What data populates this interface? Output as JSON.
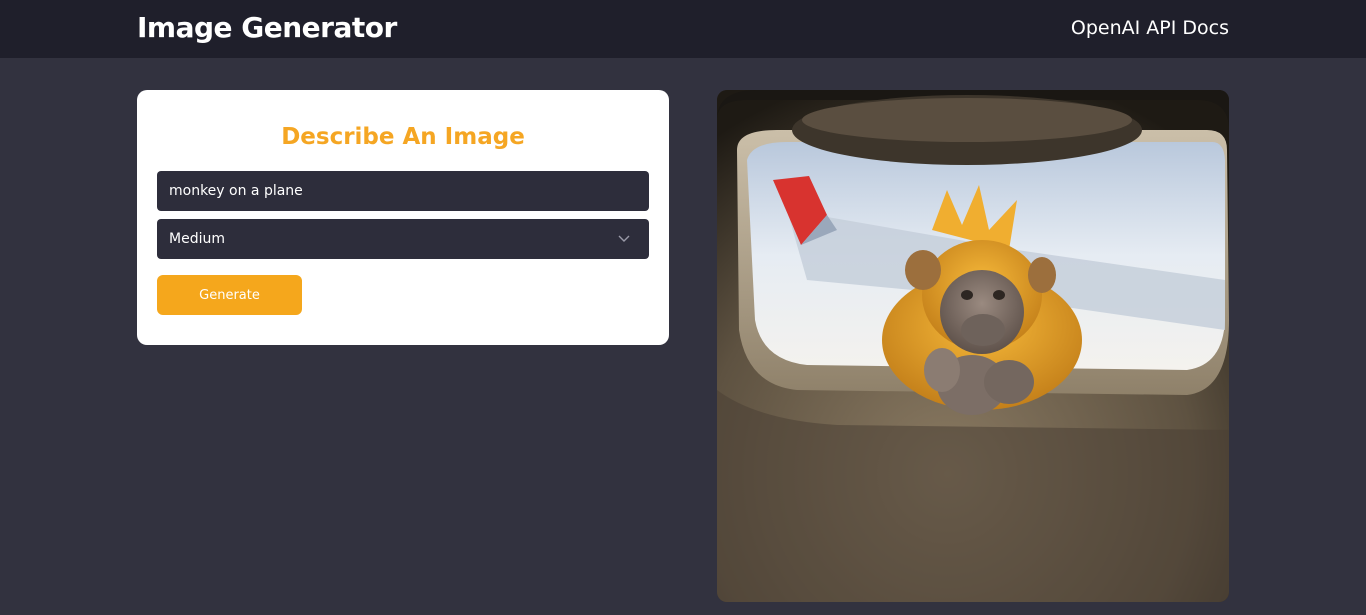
{
  "navbar": {
    "title": "Image Generator",
    "docs_link": "OpenAI API Docs"
  },
  "form": {
    "heading": "Describe An Image",
    "prompt_value": "monkey on a plane",
    "size_selected": "Medium",
    "generate_label": "Generate"
  },
  "colors": {
    "navbar_bg": "#1f1f2b",
    "page_bg": "#32323f",
    "accent": "#f5a623",
    "input_bg": "#2d2d3b"
  },
  "icons": {
    "select_arrow": "chevron-down-icon"
  },
  "generated_image": {
    "subject": "monkey sitting at an airplane window"
  }
}
